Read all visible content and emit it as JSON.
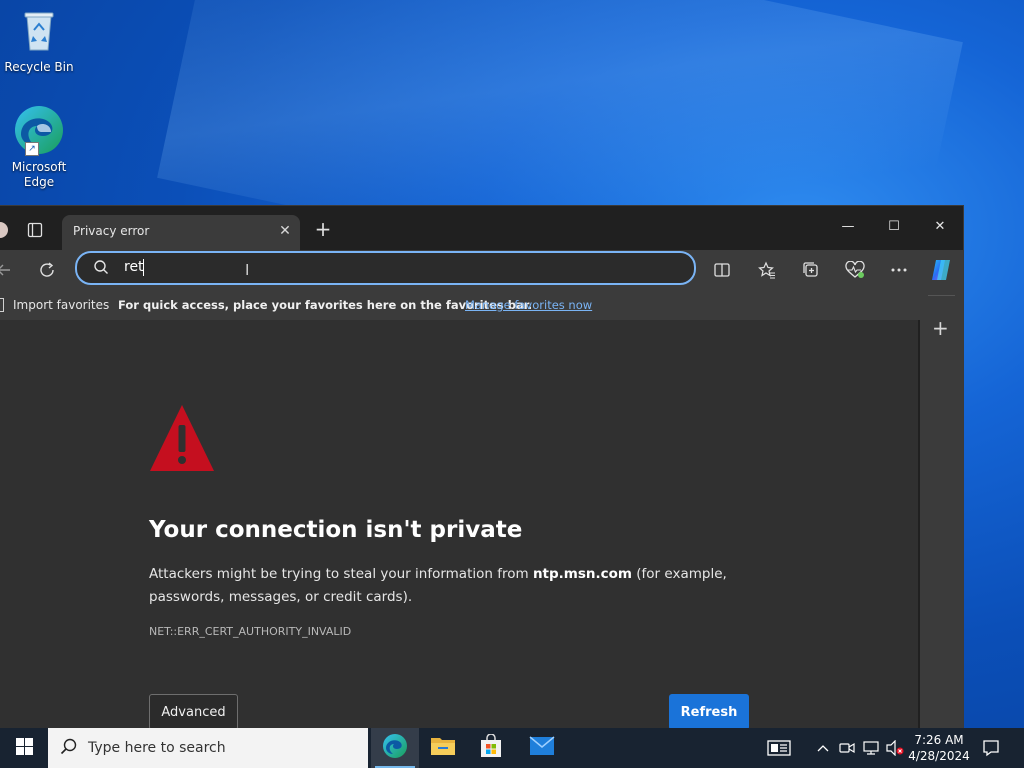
{
  "desktop": {
    "icons": [
      {
        "label": "Recycle Bin",
        "icon": "recycle-bin-icon"
      },
      {
        "label": "Microsoft\nEdge",
        "icon": "edge-icon"
      }
    ]
  },
  "browser": {
    "tab": {
      "title": "Privacy error"
    },
    "window_controls": {
      "minimize": "—",
      "maximize": "☐",
      "close": "✕"
    },
    "address_bar": {
      "value": "ret"
    },
    "favorites_bar": {
      "import_label": "Import favorites",
      "message": "For quick access, place your favorites here on the favorites bar.",
      "manage_link": "Manage favorites now"
    },
    "error_page": {
      "heading": "Your connection isn't private",
      "body_prefix": "Attackers might be trying to steal your information from ",
      "host": "ntp.msn.com",
      "body_suffix": " (for example, passwords, messages, or credit cards).",
      "error_code": "NET::ERR_CERT_AUTHORITY_INVALID",
      "advanced_label": "Advanced",
      "refresh_label": "Refresh"
    },
    "colors": {
      "accent": "#1a73d9",
      "warning": "#c50f1f",
      "link": "#7ab4f5"
    }
  },
  "taskbar": {
    "search_placeholder": "Type here to search",
    "time": "7:26 AM",
    "date": "4/28/2024"
  }
}
